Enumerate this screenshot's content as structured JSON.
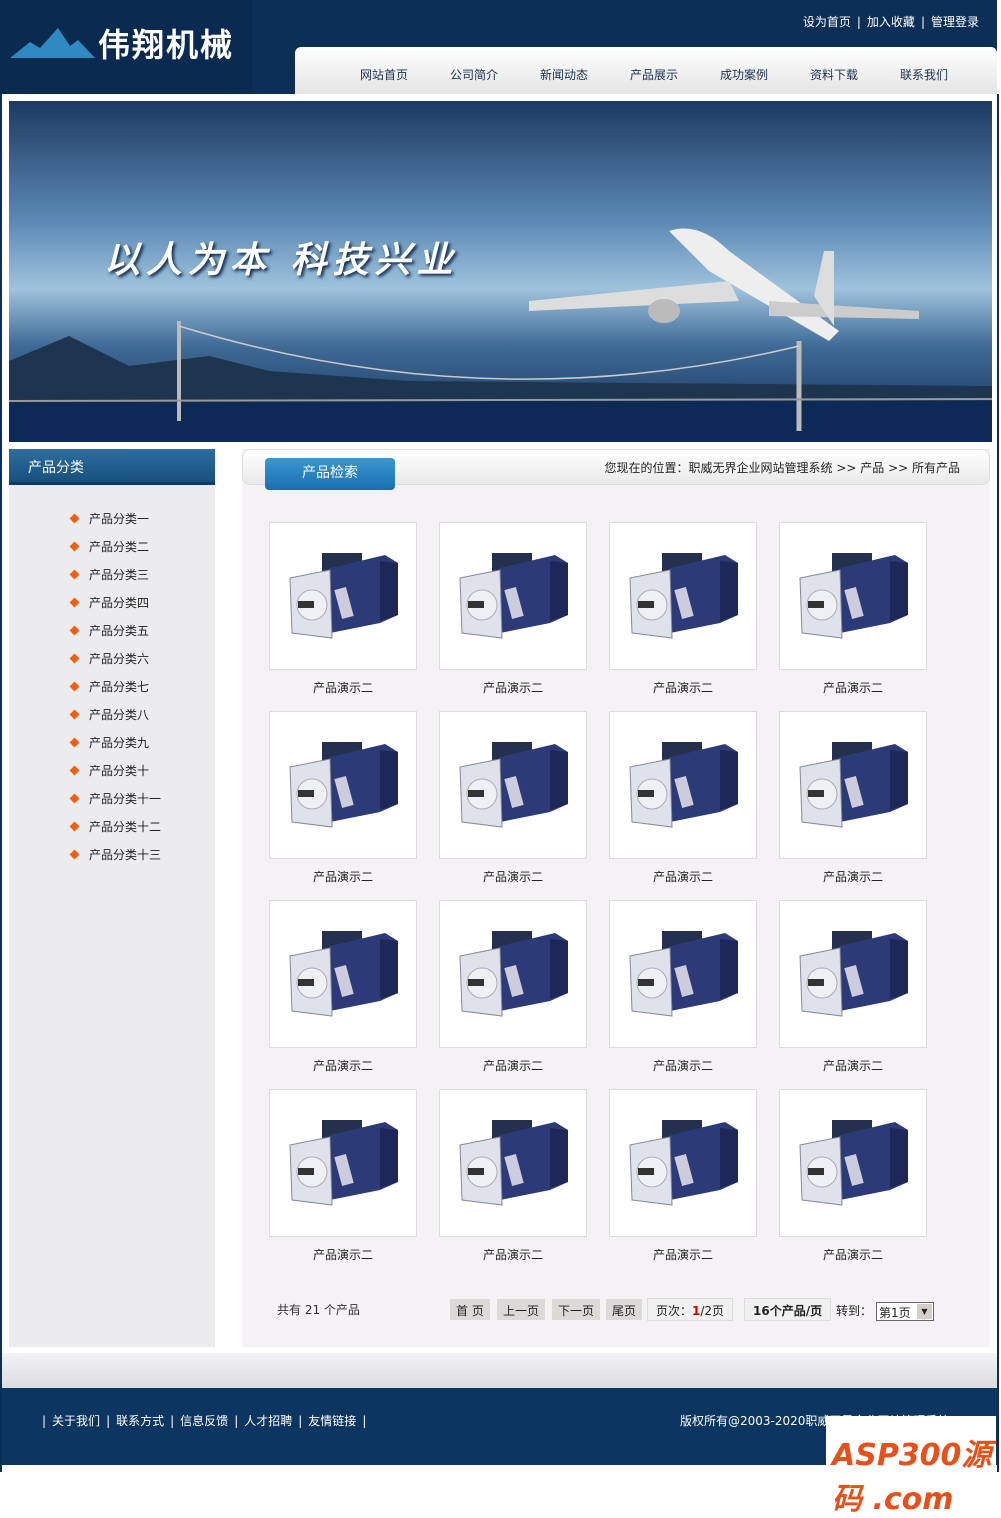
{
  "header": {
    "logo": "伟翔机械",
    "top_links": [
      "设为首页",
      "加入收藏",
      "管理登录"
    ],
    "nav": [
      "网站首页",
      "公司简介",
      "新闻动态",
      "产品展示",
      "成功案例",
      "资料下载",
      "联系我们"
    ]
  },
  "banner": {
    "slogan": "以人为本 科技兴业"
  },
  "sidebar": {
    "title": "产品分类",
    "categories": [
      "产品分类一",
      "产品分类二",
      "产品分类三",
      "产品分类四",
      "产品分类五",
      "产品分类六",
      "产品分类七",
      "产品分类八",
      "产品分类九",
      "产品分类十",
      "产品分类十一",
      "产品分类十二",
      "产品分类十三"
    ]
  },
  "main": {
    "tab": "产品检索",
    "breadcrumb": "您现在的位置：职威无界企业网站管理系统 >> 产品 >> 所有产品",
    "products": [
      "产品演示二",
      "产品演示二",
      "产品演示二",
      "产品演示二",
      "产品演示二",
      "产品演示二",
      "产品演示二",
      "产品演示二",
      "产品演示二",
      "产品演示二",
      "产品演示二",
      "产品演示二",
      "产品演示二",
      "产品演示二",
      "产品演示二",
      "产品演示二"
    ],
    "pagination": {
      "total": "共有 21 个产品",
      "first": "首 页",
      "prev": "上一页",
      "next": "下一页",
      "last": "尾页",
      "page_label": "页次：",
      "current": "1",
      "of": "/2页",
      "per_page": "16个产品/页",
      "goto": "转到：",
      "select": "第1页"
    }
  },
  "footer": {
    "links": [
      "关于我们",
      "联系方式",
      "信息反馈",
      "人才招聘",
      "友情链接"
    ],
    "copyright": "版权所有@2003-2020职威无界企业网站管理系统",
    "watermark": "ASP300源码 .com"
  }
}
